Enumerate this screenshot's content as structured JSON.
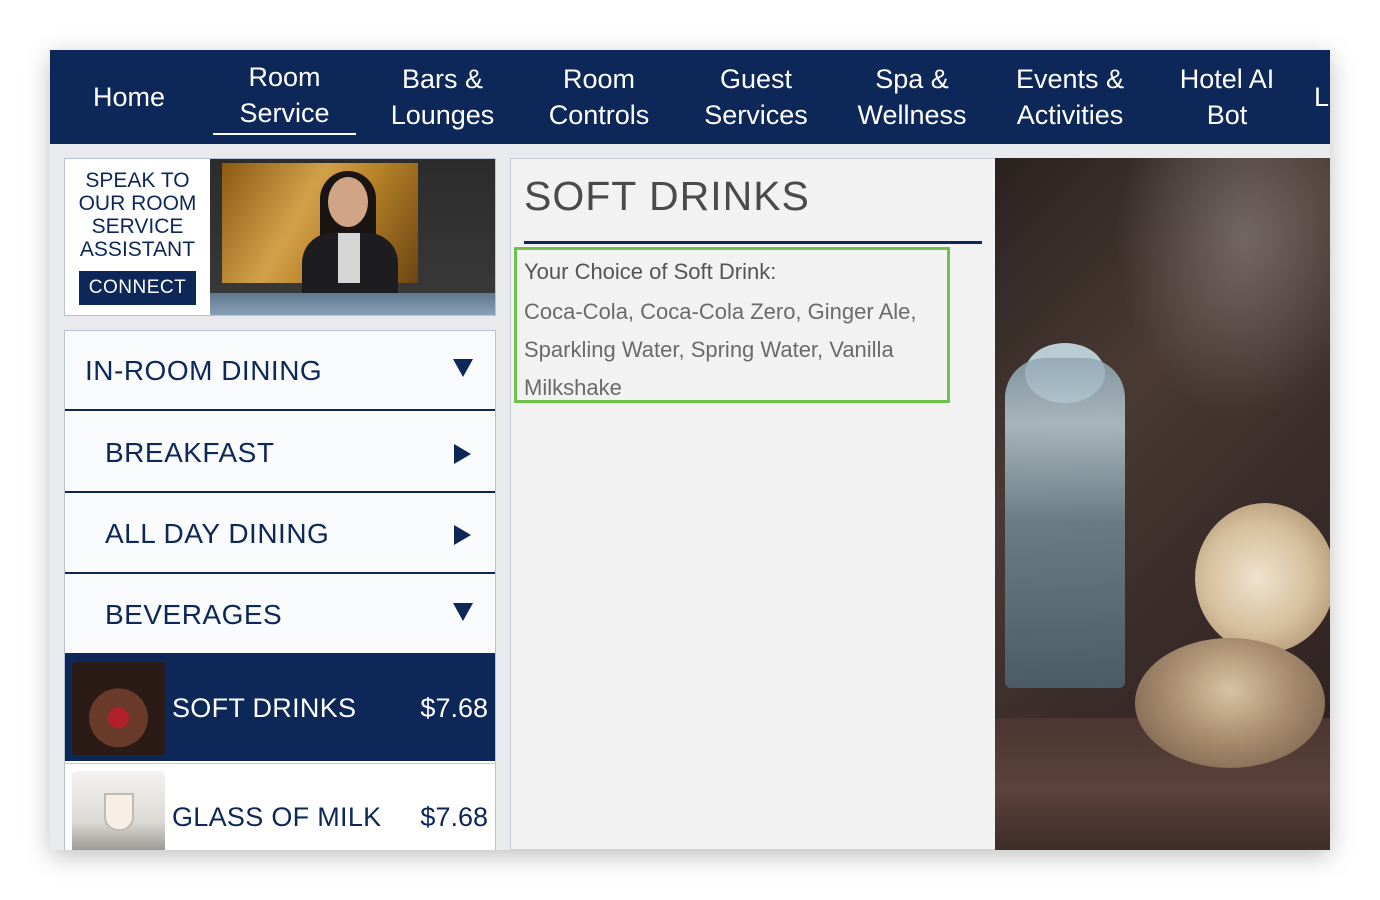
{
  "nav": {
    "items": [
      {
        "label": "Home"
      },
      {
        "label": "Room\nService"
      },
      {
        "label": "Bars &\nLounges"
      },
      {
        "label": "Room\nControls"
      },
      {
        "label": "Guest\nServices"
      },
      {
        "label": "Spa &\nWellness"
      },
      {
        "label": "Events &\nActivities"
      },
      {
        "label": "Hotel AI\nBot"
      },
      {
        "label": "L"
      }
    ],
    "active": "Room Service"
  },
  "assistant": {
    "heading": "SPEAK TO\nOUR ROOM\nSERVICE\nASSISTANT",
    "connect_label": "CONNECT"
  },
  "menu": {
    "categories": [
      {
        "label": "IN-ROOM DINING",
        "icon": "triangle-down-icon"
      },
      {
        "label": "BREAKFAST",
        "icon": "triangle-right-icon"
      },
      {
        "label": "ALL DAY DINING",
        "icon": "triangle-right-icon"
      },
      {
        "label": "BEVERAGES",
        "icon": "triangle-down-icon"
      }
    ],
    "items": [
      {
        "name": "SOFT DRINKS",
        "price": "$7.68",
        "selected": true
      },
      {
        "name": "GLASS OF MILK",
        "price": "$7.68",
        "selected": false
      }
    ]
  },
  "detail": {
    "title": "SOFT DRINKS",
    "subtitle": "Your Choice of Soft Drink:",
    "description": "Coca-Cola, Coca-Cola Zero, Ginger Ale, Sparkling Water, Spring Water, Vanilla Milkshake"
  },
  "colors": {
    "navy": "#0c2758",
    "highlight_border": "#6cc24a",
    "panel_background": "#f2f2f2"
  }
}
